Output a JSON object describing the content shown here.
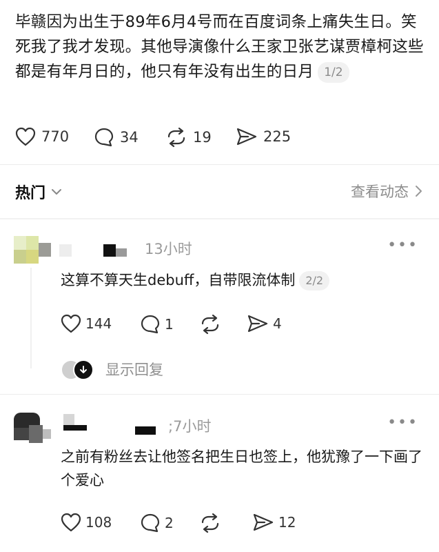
{
  "post": {
    "text": "毕赣因为出生于89年6月4号而在百度词条上痛失生日。笑死我了我才发现。其他导演像什么王家卫张艺谋贾樟柯这些都是有年月日的，他只有年没有出生的日月",
    "page_indicator": "1/2",
    "likes": "770",
    "comments": "34",
    "reposts": "19",
    "shares": "225"
  },
  "tabs": {
    "sort_label": "热门",
    "view_dynamics": "查看动态"
  },
  "comments": [
    {
      "time": "13小时",
      "text": "这算不算天生debuff，自带限流体制",
      "page_indicator": "2/2",
      "likes": "144",
      "comments": "1",
      "shares": "4",
      "show_replies": "显示回复"
    },
    {
      "time_prefix": ";",
      "time": "7小时",
      "text": "之前有粉丝去让他签名把生日也签上，他犹豫了一下画了个爱心",
      "likes": "108",
      "comments": "2",
      "shares": "12"
    }
  ],
  "colors": {
    "text": "#1a1a1a",
    "muted": "#9a9a9a",
    "pill_bg": "#f1f1f1",
    "divider": "#ececec"
  }
}
